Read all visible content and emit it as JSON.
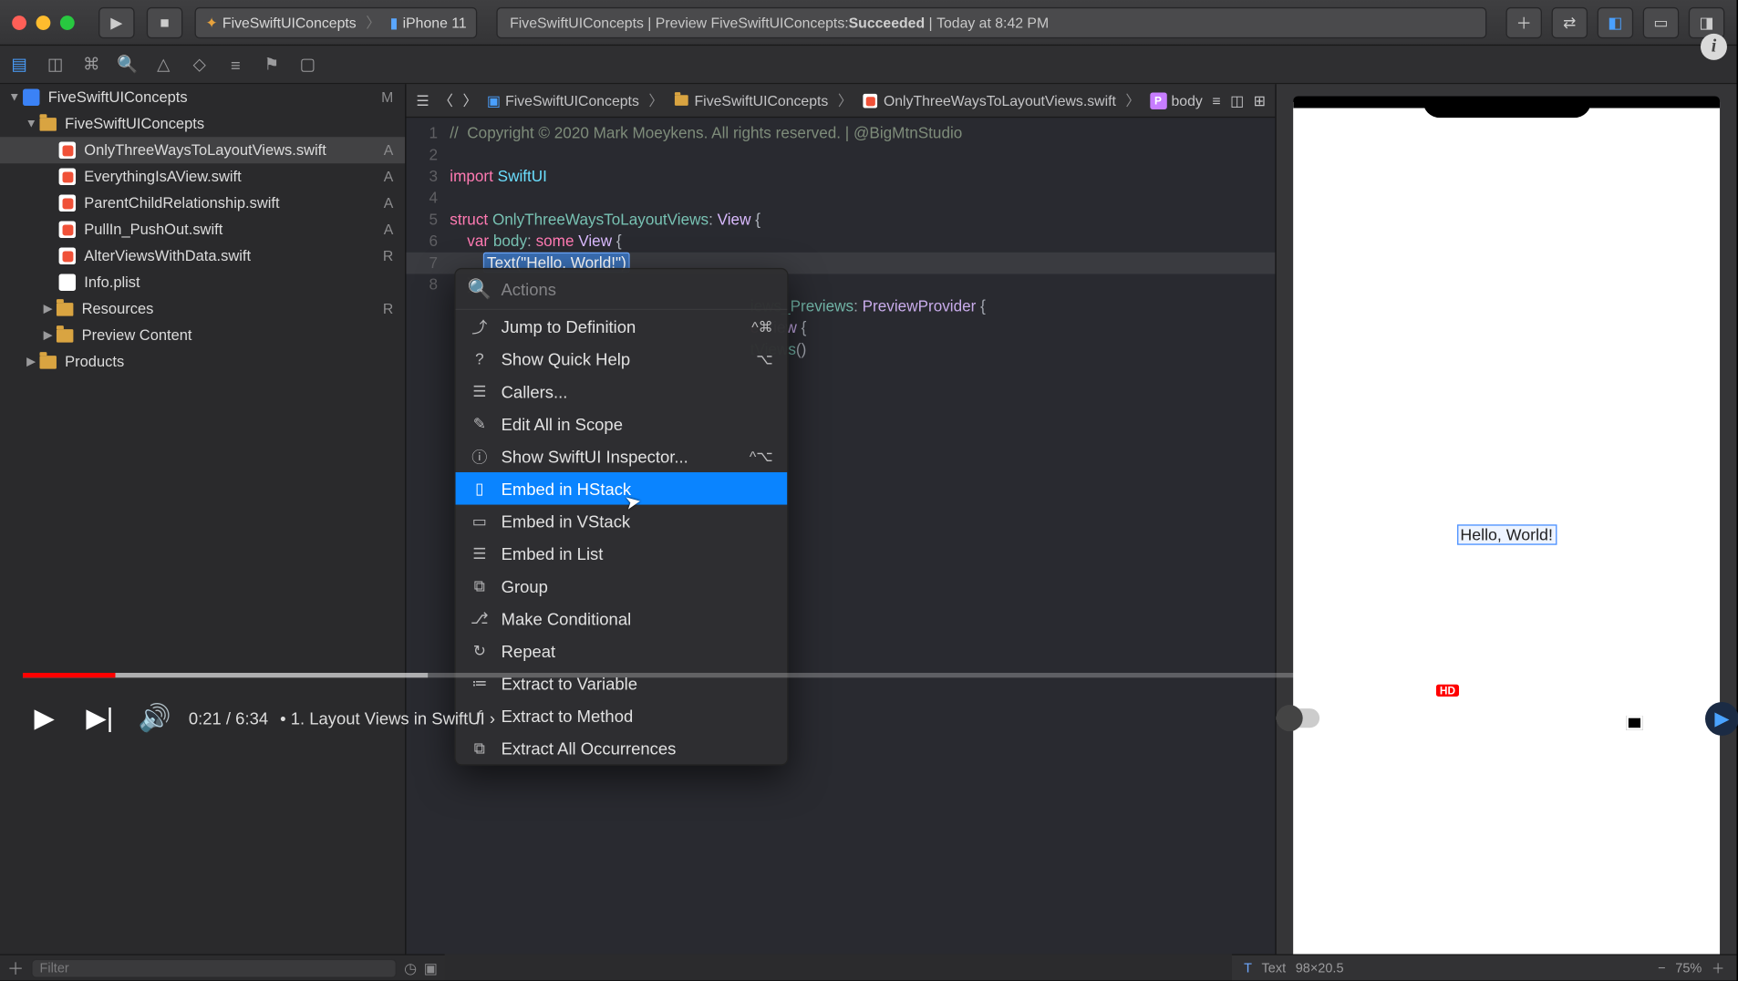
{
  "toolbar": {
    "scheme_app": "FiveSwiftUIConcepts",
    "scheme_device": "iPhone 11",
    "status_prefix": "FiveSwiftUIConcepts | Preview FiveSwiftUIConcepts: ",
    "status_result": "Succeeded",
    "status_time": "Today at 8:42 PM"
  },
  "navigator": {
    "root": "FiveSwiftUIConcepts",
    "root_ind": "M",
    "group": "FiveSwiftUIConcepts",
    "files": [
      {
        "name": "OnlyThreeWaysToLayoutViews.swift",
        "ind": "A",
        "sel": true,
        "type": "swift"
      },
      {
        "name": "EverythingIsAView.swift",
        "ind": "A",
        "sel": false,
        "type": "swift"
      },
      {
        "name": "ParentChildRelationship.swift",
        "ind": "A",
        "sel": false,
        "type": "swift"
      },
      {
        "name": "PullIn_PushOut.swift",
        "ind": "A",
        "sel": false,
        "type": "swift"
      },
      {
        "name": "AlterViewsWithData.swift",
        "ind": "R",
        "sel": false,
        "type": "swift"
      },
      {
        "name": "Info.plist",
        "ind": "",
        "sel": false,
        "type": "plist"
      }
    ],
    "folders": [
      {
        "name": "Resources",
        "ind": "R"
      },
      {
        "name": "Preview Content",
        "ind": ""
      }
    ],
    "products": "Products"
  },
  "jumpbar": {
    "items": [
      "FiveSwiftUIConcepts",
      "FiveSwiftUIConcepts",
      "OnlyThreeWaysToLayoutViews.swift",
      "body"
    ]
  },
  "code": {
    "l1": "//  Copyright © 2020 Mark Moeykens. All rights reserved. | @BigMtnStudio",
    "l3a": "import",
    "l3b": "SwiftUI",
    "l5a": "struct",
    "l5b": "OnlyThreeWaysToLayoutViews",
    "l5c": ": ",
    "l5d": "View",
    "l5e": " {",
    "l6a": "    var ",
    "l6b": "body",
    "l6c": ": ",
    "l6d": "some ",
    "l6e": "View",
    "l6f": " {",
    "l7a": "Text",
    "l7b": "(",
    "l7c": "\"Hello, World!\"",
    "l7d": ")",
    "l8": "    }",
    "l9a": "iews_Previews",
    "l9b": ": ",
    "l9c": "PreviewProvider",
    "l9d": " {",
    "l10a": "e ",
    "l10b": "View",
    "l10c": " {",
    "l11a": "tViews",
    "l11b": "()"
  },
  "popup": {
    "placeholder": "Actions",
    "items": [
      {
        "label": "Jump to Definition",
        "short": "^⌘",
        "icon": "⤴"
      },
      {
        "label": "Show Quick Help",
        "short": "⌥",
        "icon": "?"
      },
      {
        "label": "Callers...",
        "short": "",
        "icon": "☰"
      },
      {
        "label": "Edit All in Scope",
        "short": "",
        "icon": "✎"
      },
      {
        "label": "Show SwiftUI Inspector...",
        "short": "^⌥",
        "icon": "ⓘ"
      },
      {
        "label": "Embed in HStack",
        "short": "",
        "icon": "▯",
        "hl": true
      },
      {
        "label": "Embed in VStack",
        "short": "",
        "icon": "▭"
      },
      {
        "label": "Embed in List",
        "short": "",
        "icon": "☰"
      },
      {
        "label": "Group",
        "short": "",
        "icon": "⧉"
      },
      {
        "label": "Make Conditional",
        "short": "",
        "icon": "⎇"
      },
      {
        "label": "Repeat",
        "short": "",
        "icon": "↻"
      },
      {
        "label": "Extract to Variable",
        "short": "",
        "icon": "≔"
      },
      {
        "label": "Extract to Method",
        "short": "",
        "icon": "ƒ"
      },
      {
        "label": "Extract All Occurrences",
        "short": "",
        "icon": "⧉"
      }
    ]
  },
  "preview": {
    "text": "Hello, World!",
    "status_label": "Text",
    "status_size": "98×20.5",
    "zoom": "75%"
  },
  "filter": {
    "placeholder": "Filter"
  },
  "youtube": {
    "current": "0:21",
    "total": "6:34",
    "chapter": "1. Layout Views in SwiftUI",
    "hd": "HD",
    "played_pct": 5.5,
    "buffered_pct": 24
  }
}
